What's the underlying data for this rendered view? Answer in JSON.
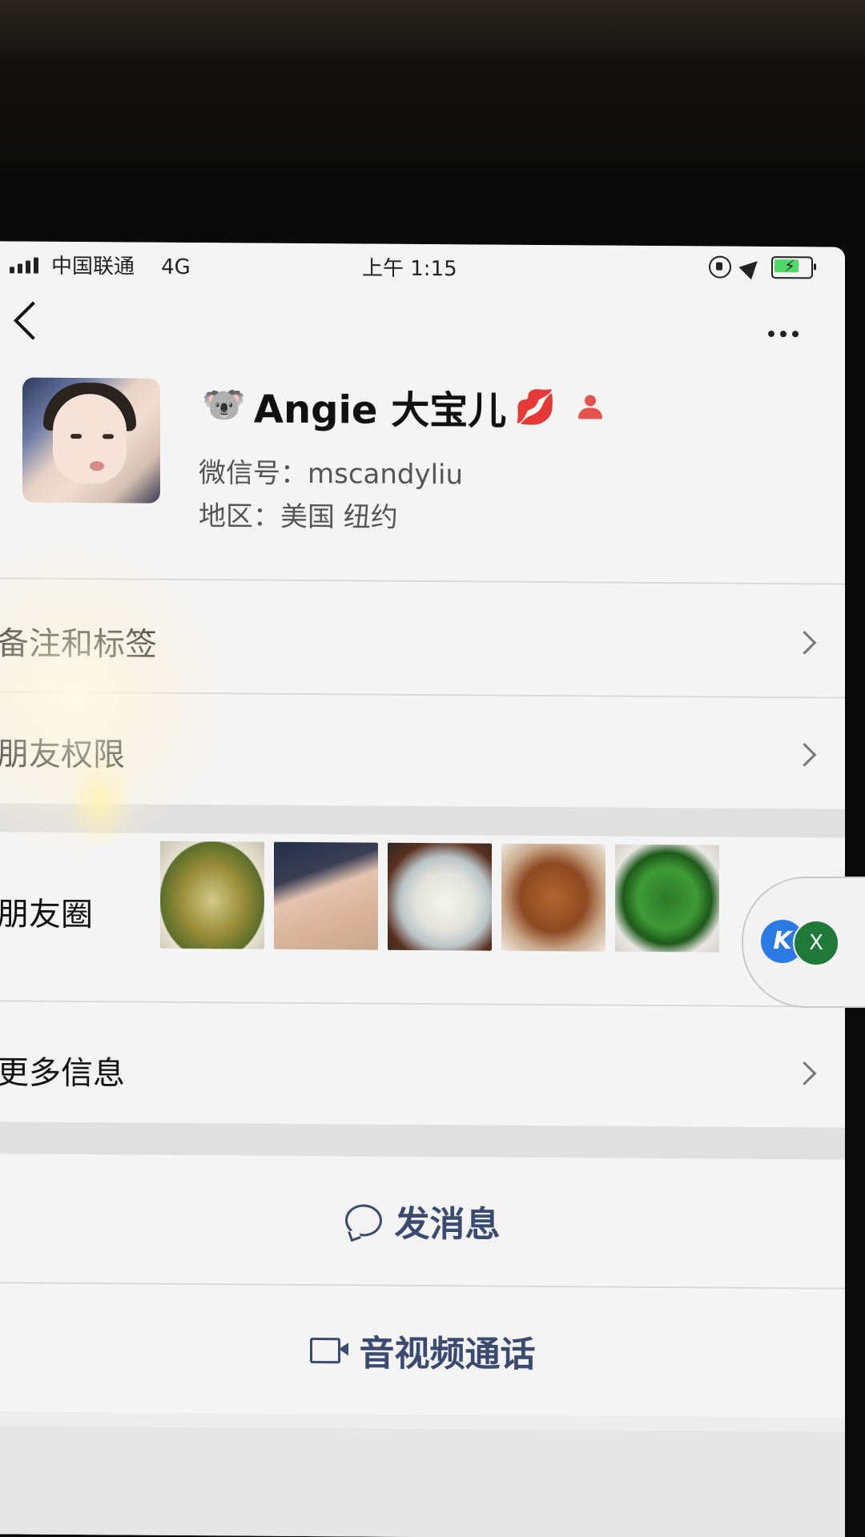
{
  "status_bar": {
    "carrier": "中国联通",
    "network": "4G",
    "time": "上午 1:15",
    "battery_percent": 75
  },
  "profile": {
    "emoji_prefix": "🐨",
    "name": "Angie 大宝儿",
    "emoji_suffix": "💋",
    "wechat_id_label": "微信号：",
    "wechat_id": "mscandyliu",
    "region_label": "地区：",
    "region": "美国 纽约"
  },
  "rows": {
    "remarks_tags": "备注和标签",
    "friend_permissions": "朋友权限",
    "moments": "朋友圈",
    "more_info": "更多信息"
  },
  "floating_widget": {
    "k_label": "K",
    "x_label": "X"
  },
  "actions": {
    "send_message": "发消息",
    "video_call": "音视频通话"
  },
  "colors": {
    "accent_text": "#3a4a70",
    "battery_fill": "#4cd964"
  }
}
